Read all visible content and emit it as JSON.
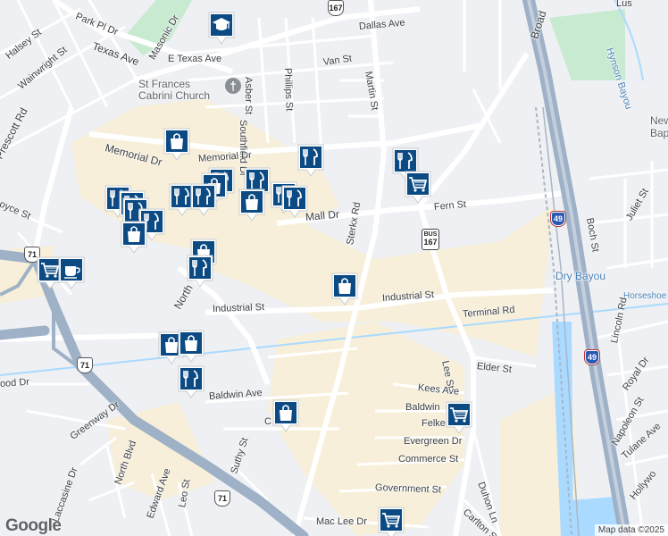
{
  "map": {
    "attribution": "Map data ©2025",
    "logo": "Google",
    "colors": {
      "background": "#eef0f3",
      "commercial": "#f7efd9",
      "park": "#c8ead0",
      "water": "#aadaff",
      "freeway": "#9fb1c7",
      "major_road": "#ffffff",
      "pin": "#0b4a83",
      "rail": "#a8b6c6"
    }
  },
  "labels": {
    "park_pl": "Park Pl Dr",
    "masonic": "Masonic Dr",
    "halsey": "Halsey St",
    "texas_ave": "Texas Ave",
    "wainwright": "Wainwright St",
    "prescott": "Prescott Rd",
    "e_texas": "E Texas Ave",
    "asber": "Asber St",
    "southfield": "Southfield Dr",
    "phillips": "Phillips St",
    "van_st": "Van St",
    "dallas": "Dallas Ave",
    "martin": "Martin St",
    "church": "St Frances Cabrini Church",
    "memorial_dr": "Memorial Dr",
    "memorial_dr2": "Memorial Dr",
    "oyce": "oyce St",
    "mall_dr": "Mall Dr",
    "fern": "Fern St",
    "sterkx": "Sterkx Rd",
    "broadway": "Broad",
    "hynson": "Hynson Bayou",
    "bapt": "New Bapt",
    "boch": "Boch St",
    "juliet": "Juliet St",
    "dry_bayou": "Dry Bayou",
    "horseshoe": "Horseshoe",
    "north_blvd_top": "North",
    "industrial": "Industrial St",
    "industrial2": "Industrial St",
    "terminal": "Terminal Rd",
    "lee": "Lee St",
    "elder": "Elder St",
    "lincoln": "Lincoln Rd",
    "royal": "Royal Dr",
    "wood_dr": "ood Dr",
    "baldwin_ave": "Baldwin Ave",
    "kees": "Kees Ave",
    "baldwin2": "Baldwin",
    "felker": "Felke",
    "napoleon": "Napoleon St",
    "greenway": "Greenway Dr",
    "evergreen": "Evergreen Dr",
    "tulane": "Tulane Ave",
    "commerce": "Commerce St",
    "north_blvd": "North Blvd",
    "suthy": "Suthy St",
    "laccasine": "Laccasine Dr",
    "edward": "Edward Ave",
    "leo": "Leo St",
    "duhon": "Duhon Ln",
    "government": "Government St",
    "hollywood": "Hollywo",
    "mac_lee": "Mac Lee Dr",
    "carlton": "Carlton St",
    "lus": "Lus",
    "c_st": "C"
  },
  "shields": {
    "us167_top": "167",
    "bus": "BUS",
    "bus167": "167",
    "us71_left": "71",
    "us71_mid": "71",
    "us71_bottom": "71",
    "i49_top": "49",
    "i49_bottom": "49"
  },
  "pins": [
    {
      "type": "education-icon"
    },
    {
      "type": "shopping-icon"
    },
    {
      "type": "restaurant-icon"
    },
    {
      "type": "restaurant-icon"
    },
    {
      "type": "restaurant-icon"
    },
    {
      "type": "restaurant-icon"
    },
    {
      "type": "shopping-icon"
    },
    {
      "type": "restaurant-icon"
    },
    {
      "type": "restaurant-icon"
    },
    {
      "type": "restaurant-icon"
    },
    {
      "type": "restaurant-icon"
    },
    {
      "type": "shopping-icon"
    },
    {
      "type": "restaurant-icon"
    },
    {
      "type": "restaurant-icon"
    },
    {
      "type": "grocery-cart-icon"
    },
    {
      "type": "restaurant-icon"
    },
    {
      "type": "restaurant-icon"
    },
    {
      "type": "shopping-icon"
    },
    {
      "type": "shopping-icon"
    },
    {
      "type": "restaurant-icon"
    },
    {
      "type": "grocery-cart-icon"
    },
    {
      "type": "cafe-icon"
    },
    {
      "type": "shopping-icon"
    },
    {
      "type": "shopping-icon"
    },
    {
      "type": "shopping-icon"
    },
    {
      "type": "restaurant-icon"
    },
    {
      "type": "shopping-icon"
    },
    {
      "type": "grocery-cart-icon"
    },
    {
      "type": "grocery-cart-icon"
    }
  ]
}
